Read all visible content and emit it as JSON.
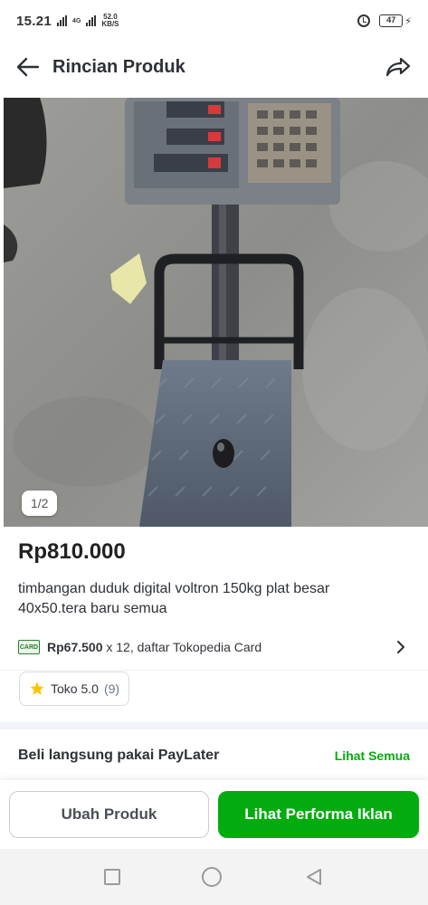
{
  "status_bar": {
    "time": "15.21",
    "network_small": "4G",
    "net_speed_value": "52.0",
    "net_speed_unit": "KB/S",
    "battery": "47"
  },
  "app_bar": {
    "title": "Rincian Produk"
  },
  "product": {
    "image_counter": "1/2",
    "price": "Rp810.000",
    "title": "timbangan duduk digital voltron 150kg plat besar 40x50.tera baru semua"
  },
  "installment": {
    "card_icon_text": "CARD",
    "amount": "Rp67.500",
    "details": " x 12, daftar Tokopedia Card"
  },
  "rating": {
    "label": "Toko 5.0",
    "count": "(9)"
  },
  "paylater": {
    "title": "Beli langsung pakai PayLater",
    "link": "Lihat Semua"
  },
  "actions": {
    "edit_label": "Ubah Produk",
    "performance_label": "Lihat Performa Iklan"
  },
  "colors": {
    "brand_green": "#03ac0e",
    "star": "#ffc400"
  },
  "icons": [
    "back-arrow-icon",
    "share-icon",
    "card-icon",
    "chevron-right-icon",
    "star-icon",
    "alarm-icon",
    "battery-icon"
  ]
}
